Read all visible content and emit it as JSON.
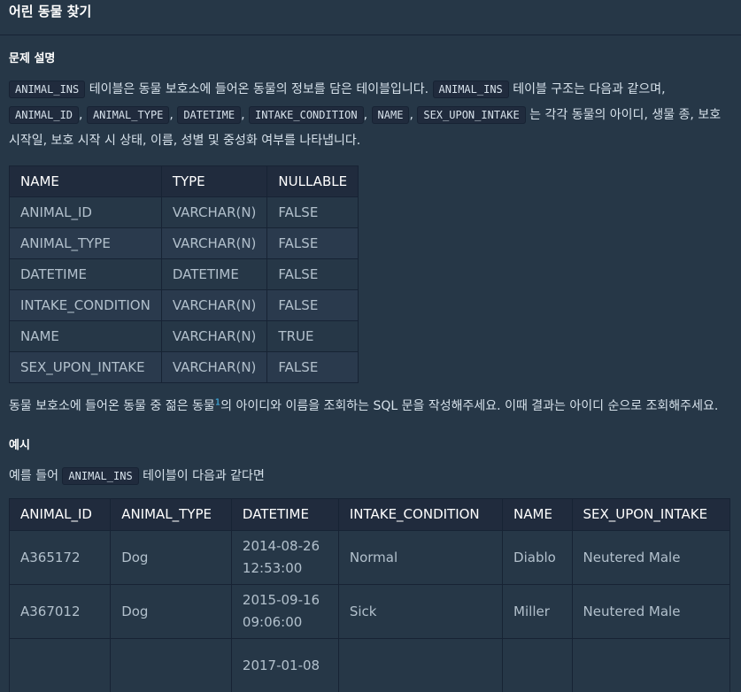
{
  "page_title": "어린 동물 찾기",
  "desc_heading": "문제 설명",
  "intro": {
    "t1": "ANIMAL_INS",
    "s1": " 테이블은 동물 보호소에 들어온 동물의 정보를 담은 테이블입니다. ",
    "t2": "ANIMAL_INS",
    "s2": " 테이블 구조는 다음과 같으며, ",
    "c1": "ANIMAL_ID",
    "c2": "ANIMAL_TYPE",
    "c3": "DATETIME",
    "c4": "INTAKE_CONDITION",
    "c5": "NAME",
    "c6": "SEX_UPON_INTAKE",
    "sep": ", ",
    "s3": " 는 각각 동물의 아이디, 생물 종, 보호 시작일, 보호 시작 시 상태, 이름, 성별 및 중성화 여부를 나타냅니다."
  },
  "schema_table": {
    "headers": [
      "NAME",
      "TYPE",
      "NULLABLE"
    ],
    "rows": [
      [
        "ANIMAL_ID",
        "VARCHAR(N)",
        "FALSE"
      ],
      [
        "ANIMAL_TYPE",
        "VARCHAR(N)",
        "FALSE"
      ],
      [
        "DATETIME",
        "DATETIME",
        "FALSE"
      ],
      [
        "INTAKE_CONDITION",
        "VARCHAR(N)",
        "FALSE"
      ],
      [
        "NAME",
        "VARCHAR(N)",
        "TRUE"
      ],
      [
        "SEX_UPON_INTAKE",
        "VARCHAR(N)",
        "FALSE"
      ]
    ]
  },
  "question": {
    "before": "동물 보호소에 들어온 동물 중 젊은 동물",
    "footnote": "1",
    "after": "의 아이디와 이름을 조회하는 SQL 문을 작성해주세요. 이때 결과는 아이디 순으로 조회해주세요."
  },
  "example_heading": "예시",
  "example_intro": {
    "before": "예를 들어 ",
    "code": "ANIMAL_INS",
    "after": " 테이블이 다음과 같다면"
  },
  "example_table": {
    "headers": [
      "ANIMAL_ID",
      "ANIMAL_TYPE",
      "DATETIME",
      "INTAKE_CONDITION",
      "NAME",
      "SEX_UPON_INTAKE"
    ],
    "rows": [
      {
        "id": "A365172",
        "type": "Dog",
        "date": "2014-08-26",
        "time": "12:53:00",
        "cond": "Normal",
        "name": "Diablo",
        "sex": "Neutered Male"
      },
      {
        "id": "A367012",
        "type": "Dog",
        "date": "2015-09-16",
        "time": "09:06:00",
        "cond": "Sick",
        "name": "Miller",
        "sex": "Neutered Male"
      },
      {
        "id": "",
        "type": "",
        "date": "2017-01-08",
        "time": "",
        "cond": "",
        "name": "",
        "sex": ""
      }
    ]
  }
}
